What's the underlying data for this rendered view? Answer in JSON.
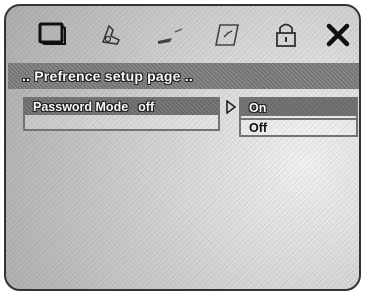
{
  "toolbar": {
    "icons": [
      {
        "name": "monitor-icon"
      },
      {
        "name": "speaker-icon"
      },
      {
        "name": "video-icon"
      },
      {
        "name": "preference-icon"
      },
      {
        "name": "lock-icon"
      },
      {
        "name": "close-icon"
      }
    ]
  },
  "header": {
    "title": ".. Prefrence setup page .."
  },
  "setting": {
    "label": "Password Mode",
    "value": "off"
  },
  "options": {
    "items": [
      "On",
      "Off"
    ],
    "selected": "On"
  },
  "colors": {
    "highlight": "#6e6e6e",
    "border": "#777777",
    "text_on_highlight": "#ffffff"
  }
}
